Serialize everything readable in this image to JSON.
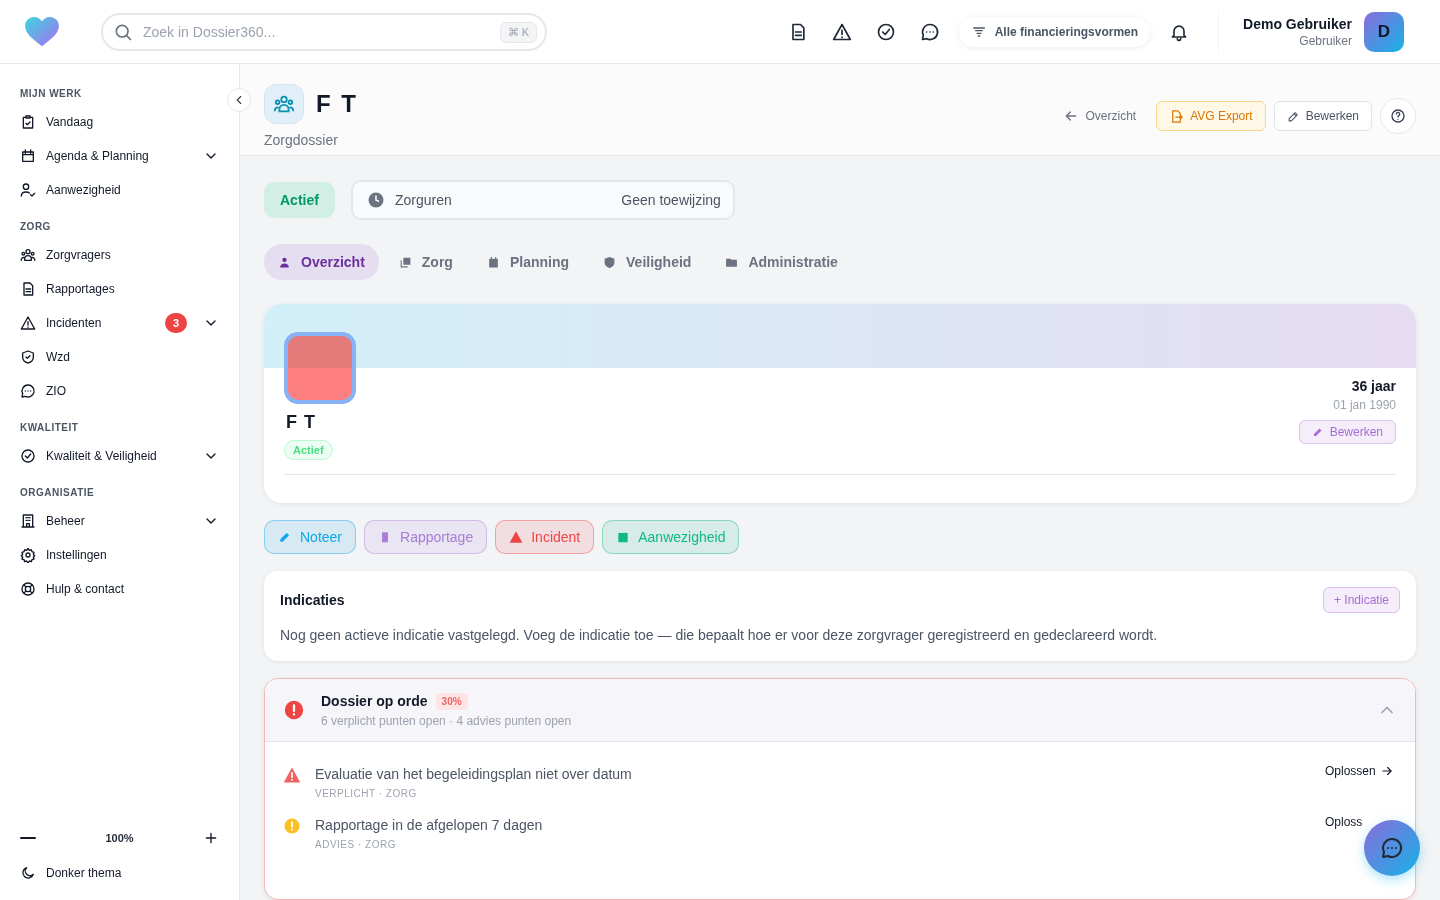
{
  "topbar": {
    "search": {
      "placeholder": "Zoek in Dossier360...",
      "shortcut": "⌘ K"
    },
    "filter": "Alle financieringsvormen",
    "user": {
      "name": "Demo Gebruiker",
      "role": "Gebruiker",
      "initial": "D"
    }
  },
  "sidebar": {
    "sections": [
      {
        "title": "MIJN WERK",
        "items": [
          {
            "label": "Vandaag",
            "expandable": false
          },
          {
            "label": "Agenda & Planning",
            "expandable": true
          },
          {
            "label": "Aanwezigheid",
            "expandable": false
          }
        ]
      },
      {
        "title": "ZORG",
        "items": [
          {
            "label": "Zorgvragers",
            "expandable": false
          },
          {
            "label": "Rapportages",
            "expandable": false
          },
          {
            "label": "Incidenten",
            "badge": "3",
            "expandable": true
          },
          {
            "label": "Wzd",
            "expandable": false
          },
          {
            "label": "ZIO",
            "expandable": false
          }
        ]
      },
      {
        "title": "KWALITEIT",
        "items": [
          {
            "label": "Kwaliteit & Veiligheid",
            "expandable": true
          }
        ]
      },
      {
        "title": "ORGANISATIE",
        "items": [
          {
            "label": "Beheer",
            "expandable": true
          },
          {
            "label": "Instellingen",
            "expandable": false
          },
          {
            "label": "Hulp & contact",
            "expandable": false
          }
        ]
      }
    ],
    "zoom": "100%",
    "theme_toggle": "Donker thema"
  },
  "header": {
    "title": "F T",
    "subtitle": "Zorgdossier",
    "back_link": "Overzicht",
    "export_button": "AVG Export",
    "edit_button": "Bewerken"
  },
  "status": {
    "label": "Actief"
  },
  "hours": {
    "label": "Zorguren",
    "value": "Geen toewijzing"
  },
  "tabs": [
    {
      "label": "Overzicht",
      "selected": true
    },
    {
      "label": "Zorg",
      "selected": false
    },
    {
      "label": "Planning",
      "selected": false
    },
    {
      "label": "Veiligheid",
      "selected": false
    },
    {
      "label": "Administratie",
      "selected": false
    }
  ],
  "profile": {
    "name": "F T",
    "status": "Actief",
    "age": "36 jaar",
    "birthdate": "01 jan 1990",
    "edit_button": "Bewerken"
  },
  "quick_actions": [
    {
      "label": "Noteer",
      "color": "#0ea5e9"
    },
    {
      "label": "Rapportage",
      "color": "#a77bd6"
    },
    {
      "label": "Incident",
      "color": "#ef4444"
    },
    {
      "label": "Aanwezigheid",
      "color": "#10b981"
    }
  ],
  "indicaties": {
    "title": "Indicaties",
    "add_button": "+ Indicatie",
    "text": "Nog geen actieve indicatie vastgelegd. Voeg de indicatie toe — die bepaalt hoe er voor deze zorgvrager geregistreerd en gedeclareerd wordt."
  },
  "checklist": {
    "title": "Dossier op orde",
    "percent": "30%",
    "summary": "6 verplicht punten open · 4 advies punten open",
    "expanded": true,
    "items": [
      {
        "kind": "required",
        "title": "Evaluatie van het begeleidingsplan niet over datum",
        "meta": "VERPLICHT · ZORG",
        "action": "Oplossen",
        "arrow": true
      },
      {
        "kind": "advice",
        "title": "Rapportage in de afgelopen 7 dagen",
        "meta": "ADVIES · ZORG",
        "action": "Oploss",
        "arrow": false
      }
    ]
  }
}
